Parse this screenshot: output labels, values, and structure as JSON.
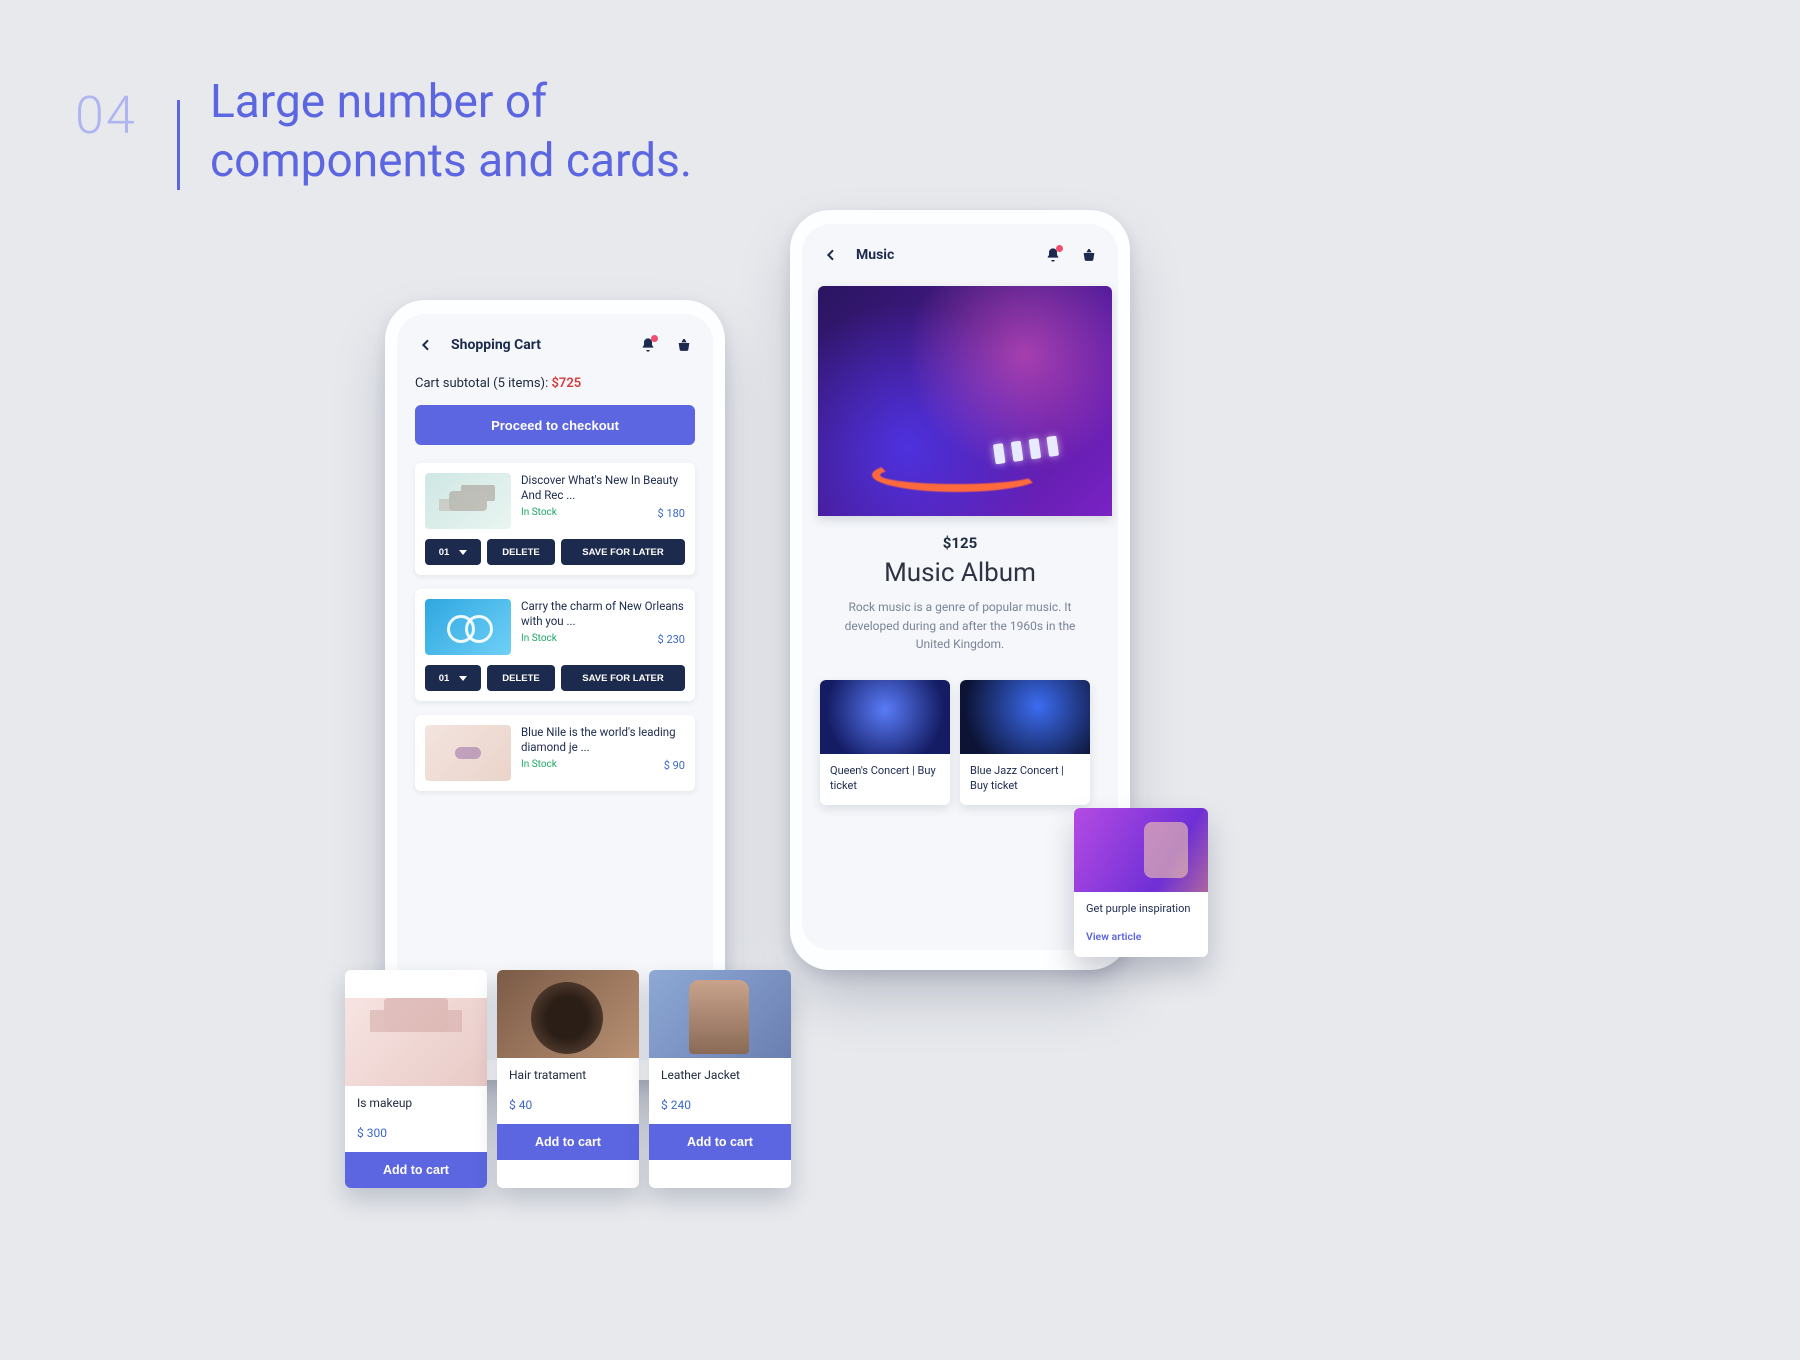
{
  "section": {
    "number": "04",
    "title_line1": "Large number of",
    "title_line2": "components and cards."
  },
  "cart_phone": {
    "header": "Shopping Cart",
    "subtotal_prefix": "Cart subtotal (5 items): ",
    "subtotal_amount": "$725",
    "checkout_label": "Proceed to checkout",
    "qty_label": "01",
    "delete_label": "DELETE",
    "save_label": "SAVE FOR LATER",
    "items": [
      {
        "title": "Discover What's New In Beauty And Rec ...",
        "stock": "In Stock",
        "price": "$ 180"
      },
      {
        "title": "Carry the charm of New Orleans with you ...",
        "stock": "In Stock",
        "price": "$ 230"
      },
      {
        "title": "Blue Nile is the world's leading diamond je ...",
        "stock": "In Stock",
        "price": "$ 90"
      }
    ]
  },
  "music_phone": {
    "header": "Music",
    "price": "$125",
    "title": "Music Album",
    "desc": "Rock music is a genre of popular music. It developed during and after the 1960s in the United Kingdom.",
    "concerts": [
      {
        "label": "Queen's Concert | Buy ticket"
      },
      {
        "label": "Blue Jazz Concert | Buy ticket"
      }
    ]
  },
  "purple_card": {
    "title": "Get purple inspiration",
    "link": "View article"
  },
  "products": [
    {
      "title": "Is makeup",
      "price": "$ 300",
      "atc": "Add to cart"
    },
    {
      "title": "Hair tratament",
      "price": "$ 40",
      "atc": "Add to cart"
    },
    {
      "title": "Leather Jacket",
      "price": "$ 240",
      "atc": "Add to cart"
    }
  ]
}
